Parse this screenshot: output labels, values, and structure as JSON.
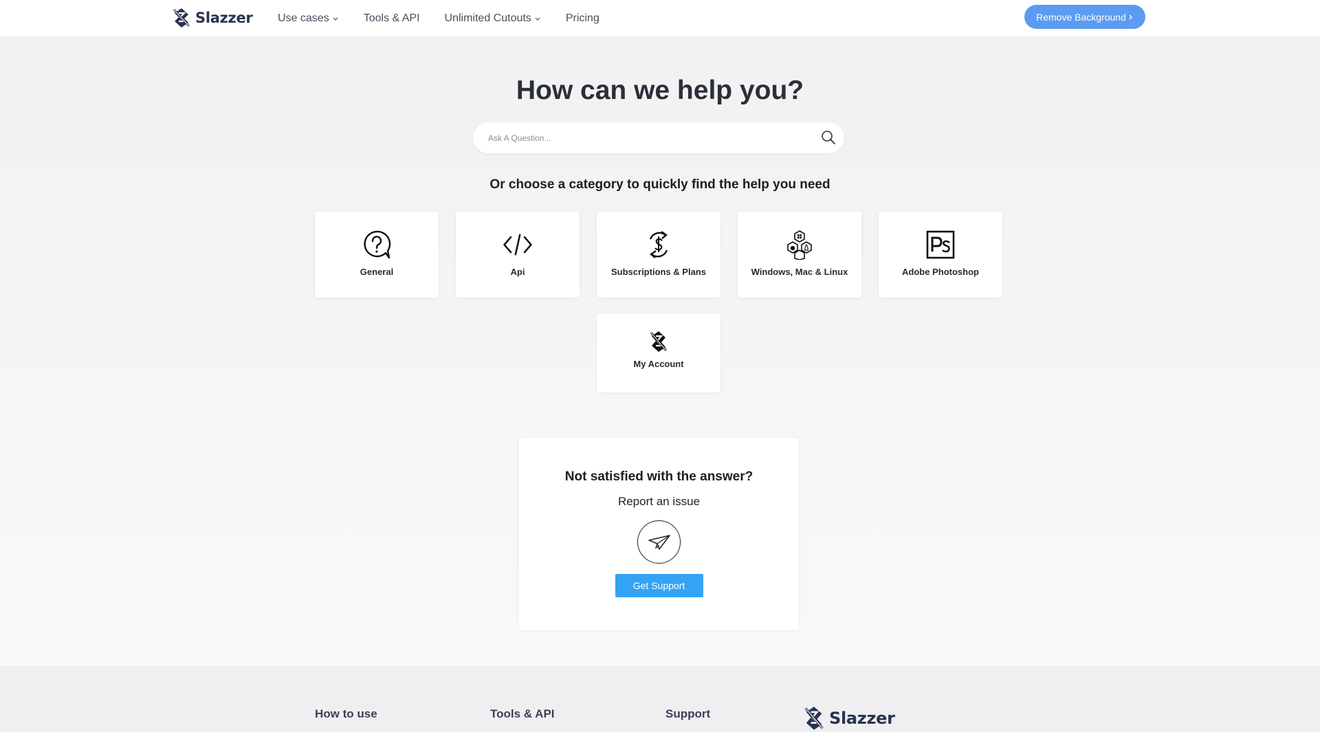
{
  "header": {
    "logo_text": "Slazzer",
    "nav": [
      {
        "label": "Use cases",
        "has_dropdown": true
      },
      {
        "label": "Tools & API",
        "has_dropdown": false
      },
      {
        "label": "Unlimited Cutouts",
        "has_dropdown": true
      },
      {
        "label": "Pricing",
        "has_dropdown": false
      }
    ],
    "cta_label": "Remove Background",
    "accent_color": "#5b9bf1"
  },
  "hero": {
    "title": "How can we help you?",
    "search_placeholder": "Ask A Question...",
    "search_value": "",
    "subtitle": "Or choose a category to quickly find the help you need"
  },
  "categories": [
    {
      "label": "General",
      "icon": "question-bubble-icon"
    },
    {
      "label": "Api",
      "icon": "code-icon"
    },
    {
      "label": "Subscriptions & Plans",
      "icon": "dollar-refresh-icon"
    },
    {
      "label": "Windows, Mac & Linux",
      "icon": "os-hexagons-icon"
    },
    {
      "label": "Adobe Photoshop",
      "icon": "photoshop-icon"
    },
    {
      "label": "My Account",
      "icon": "slazzer-logo-icon"
    }
  ],
  "support": {
    "question": "Not satisfied with the answer?",
    "report": "Report an issue",
    "button_label": "Get Support",
    "button_color": "#35a3f3",
    "icon": "paper-plane-icon"
  },
  "footer": {
    "columns": [
      "How to use",
      "Tools & API",
      "Support"
    ],
    "logo_text": "Slazzer"
  }
}
